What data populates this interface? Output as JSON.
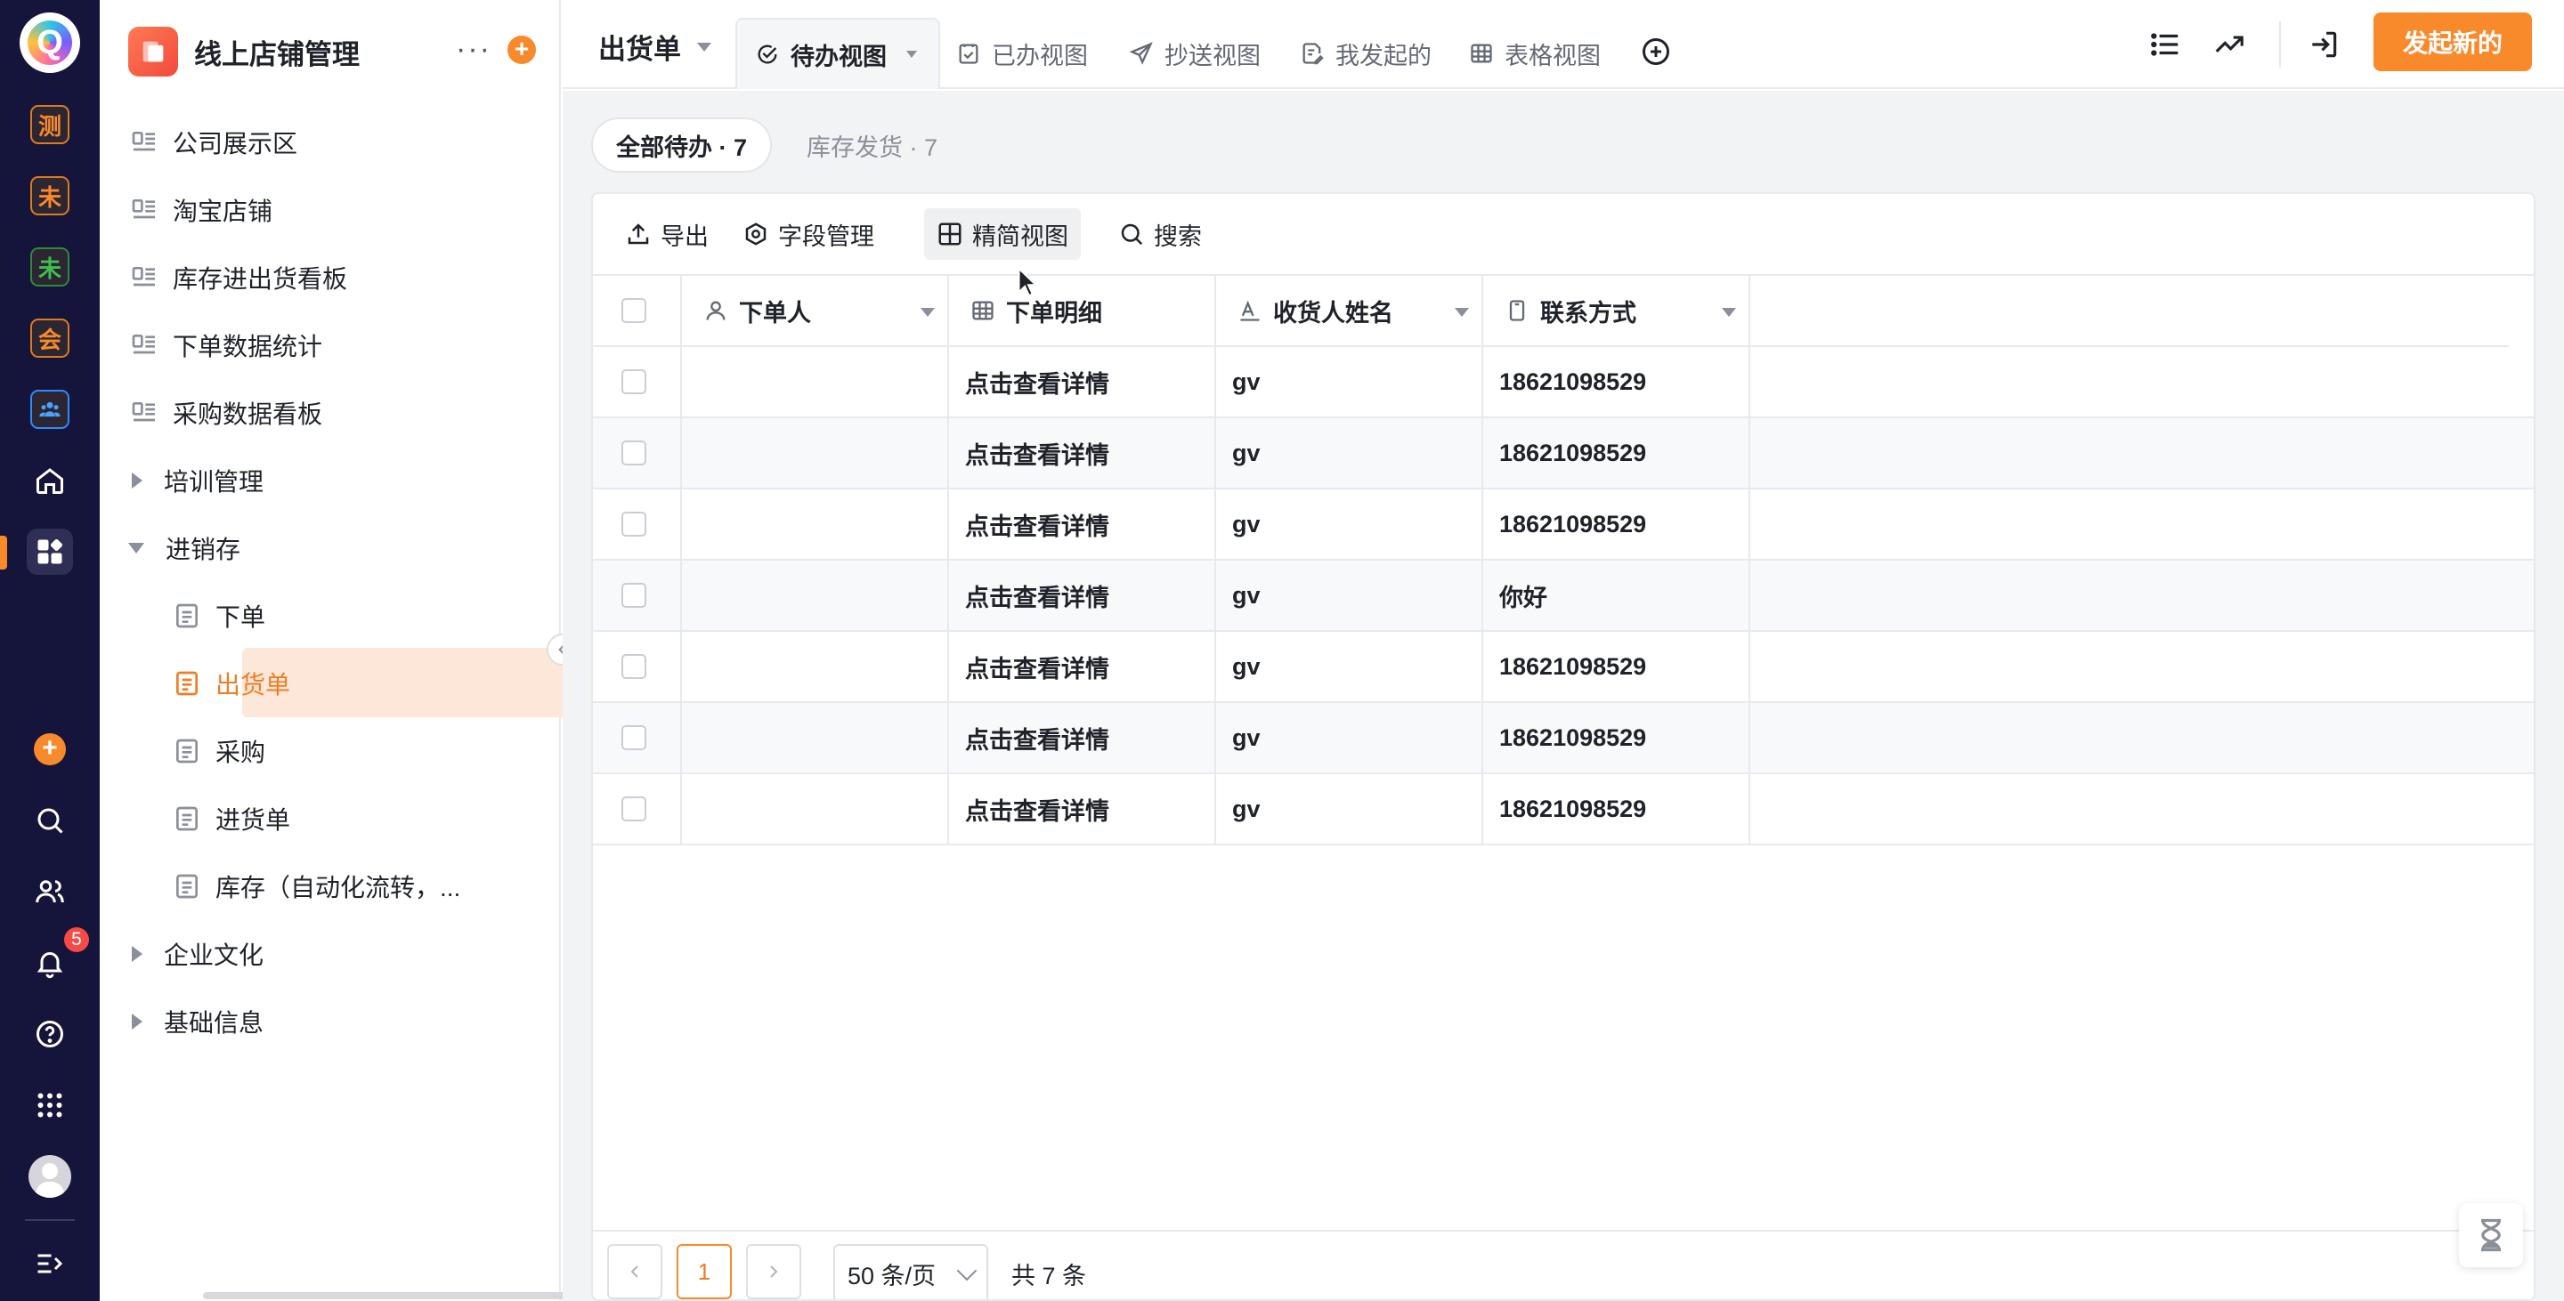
{
  "rail": {
    "apps": [
      {
        "label": "测",
        "color": "#f88a2c"
      },
      {
        "label": "未",
        "color": "#f88a2c"
      },
      {
        "label": "未",
        "color": "#3ec04f"
      },
      {
        "label": "会",
        "color": "#f88a2c"
      },
      {
        "icon": "team-icon",
        "color": "#2f8cff"
      }
    ],
    "notification_count": "5"
  },
  "sidebar": {
    "title": "线上店铺管理",
    "more": "···",
    "items": [
      {
        "label": "公司展示区"
      },
      {
        "label": "淘宝店铺"
      },
      {
        "label": "库存进出货看板"
      },
      {
        "label": "下单数据统计"
      },
      {
        "label": "采购数据看板"
      },
      {
        "label": "培训管理"
      },
      {
        "label": "进销存"
      },
      {
        "label": "下单"
      },
      {
        "label": "出货单"
      },
      {
        "label": "采购"
      },
      {
        "label": "进货单"
      },
      {
        "label": "库存（自动化流转，..."
      },
      {
        "label": "企业文化"
      },
      {
        "label": "基础信息"
      }
    ]
  },
  "header": {
    "form_title": "出货单",
    "tabs": [
      {
        "label": "待办视图"
      },
      {
        "label": "已办视图"
      },
      {
        "label": "抄送视图"
      },
      {
        "label": "我发起的"
      },
      {
        "label": "表格视图"
      }
    ],
    "primary_button": "发起新的"
  },
  "filters": {
    "all_todo": "全部待办 · 7",
    "stock_ship": "库存发货 · 7"
  },
  "toolbar": {
    "export": "导出",
    "fields": "字段管理",
    "compact_view": "精简视图",
    "search": "搜索"
  },
  "table": {
    "columns": [
      {
        "label": "下单人"
      },
      {
        "label": "下单明细"
      },
      {
        "label": "收货人姓名"
      },
      {
        "label": "联系方式"
      }
    ],
    "rows": [
      {
        "orderer": "",
        "detail": "点击查看详情",
        "receiver": "gv",
        "contact": "18621098529"
      },
      {
        "orderer": "",
        "detail": "点击查看详情",
        "receiver": "gv",
        "contact": "18621098529"
      },
      {
        "orderer": "",
        "detail": "点击查看详情",
        "receiver": "gv",
        "contact": "18621098529"
      },
      {
        "orderer": "",
        "detail": "点击查看详情",
        "receiver": "gv",
        "contact": "你好"
      },
      {
        "orderer": "",
        "detail": "点击查看详情",
        "receiver": "gv",
        "contact": "18621098529"
      },
      {
        "orderer": "",
        "detail": "点击查看详情",
        "receiver": "gv",
        "contact": "18621098529"
      },
      {
        "orderer": "",
        "detail": "点击查看详情",
        "receiver": "gv",
        "contact": "18621098529"
      }
    ]
  },
  "pagination": {
    "current_page": "1",
    "page_size": "50 条/页",
    "total": "共 7 条"
  },
  "colors": {
    "accent": "#f88a2c",
    "rail_bg": "#15143a",
    "selected_bg": "#fde7d8"
  }
}
